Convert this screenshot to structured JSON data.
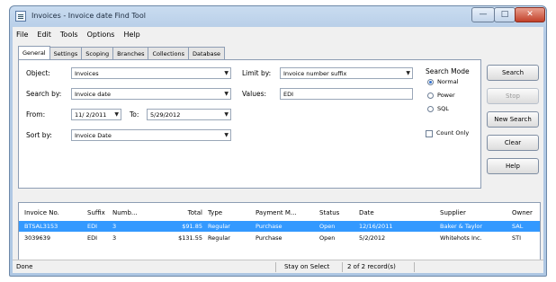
{
  "window": {
    "title": "Invoices - Invoice date Find Tool"
  },
  "title_buttons": {
    "minimize": "—",
    "maximize": "□",
    "close": "✕"
  },
  "menu": [
    "File",
    "Edit",
    "Tools",
    "Options",
    "Help"
  ],
  "tabs": [
    "General",
    "Settings",
    "Scoping",
    "Branches",
    "Collections",
    "Database"
  ],
  "form": {
    "object_label": "Object:",
    "object_value": "Invoices",
    "search_by_label": "Search by:",
    "search_by_value": "Invoice date",
    "from_label": "From:",
    "from_value": "11/ 2/2011",
    "to_label": "To:",
    "to_value": "5/29/2012",
    "sort_by_label": "Sort by:",
    "sort_by_value": "Invoice Date",
    "limit_by_label": "Limit by:",
    "limit_by_value": "Invoice number suffix",
    "values_label": "Values:",
    "values_value": "EDI"
  },
  "search_mode": {
    "label": "Search Mode",
    "options": [
      "Normal",
      "Power",
      "SQL"
    ],
    "selected": "Normal"
  },
  "count_only_label": "Count Only",
  "buttons": {
    "search": "Search",
    "stop": "Stop",
    "new_search": "New Search",
    "clear": "Clear",
    "help": "Help"
  },
  "results": {
    "columns": [
      "Invoice No.",
      "Suffix",
      "Numb...",
      "Total",
      "Type",
      "Payment M...",
      "Status",
      "Date",
      "Supplier",
      "Owner"
    ],
    "rows": [
      [
        "BTSAL3153",
        "EDI",
        "3",
        "$91.85",
        "Regular",
        "Purchase",
        "Open",
        "12/16/2011",
        "Baker & Taylor",
        "SAL"
      ],
      [
        "3039639",
        "EDI",
        "3",
        "$131.55",
        "Regular",
        "Purchase",
        "Open",
        "5/2/2012",
        "Whitehots Inc.",
        "STI"
      ]
    ]
  },
  "status_bar": {
    "state": "Done",
    "stay_on_select": "Stay on Select",
    "records": "2 of 2 record(s)"
  }
}
